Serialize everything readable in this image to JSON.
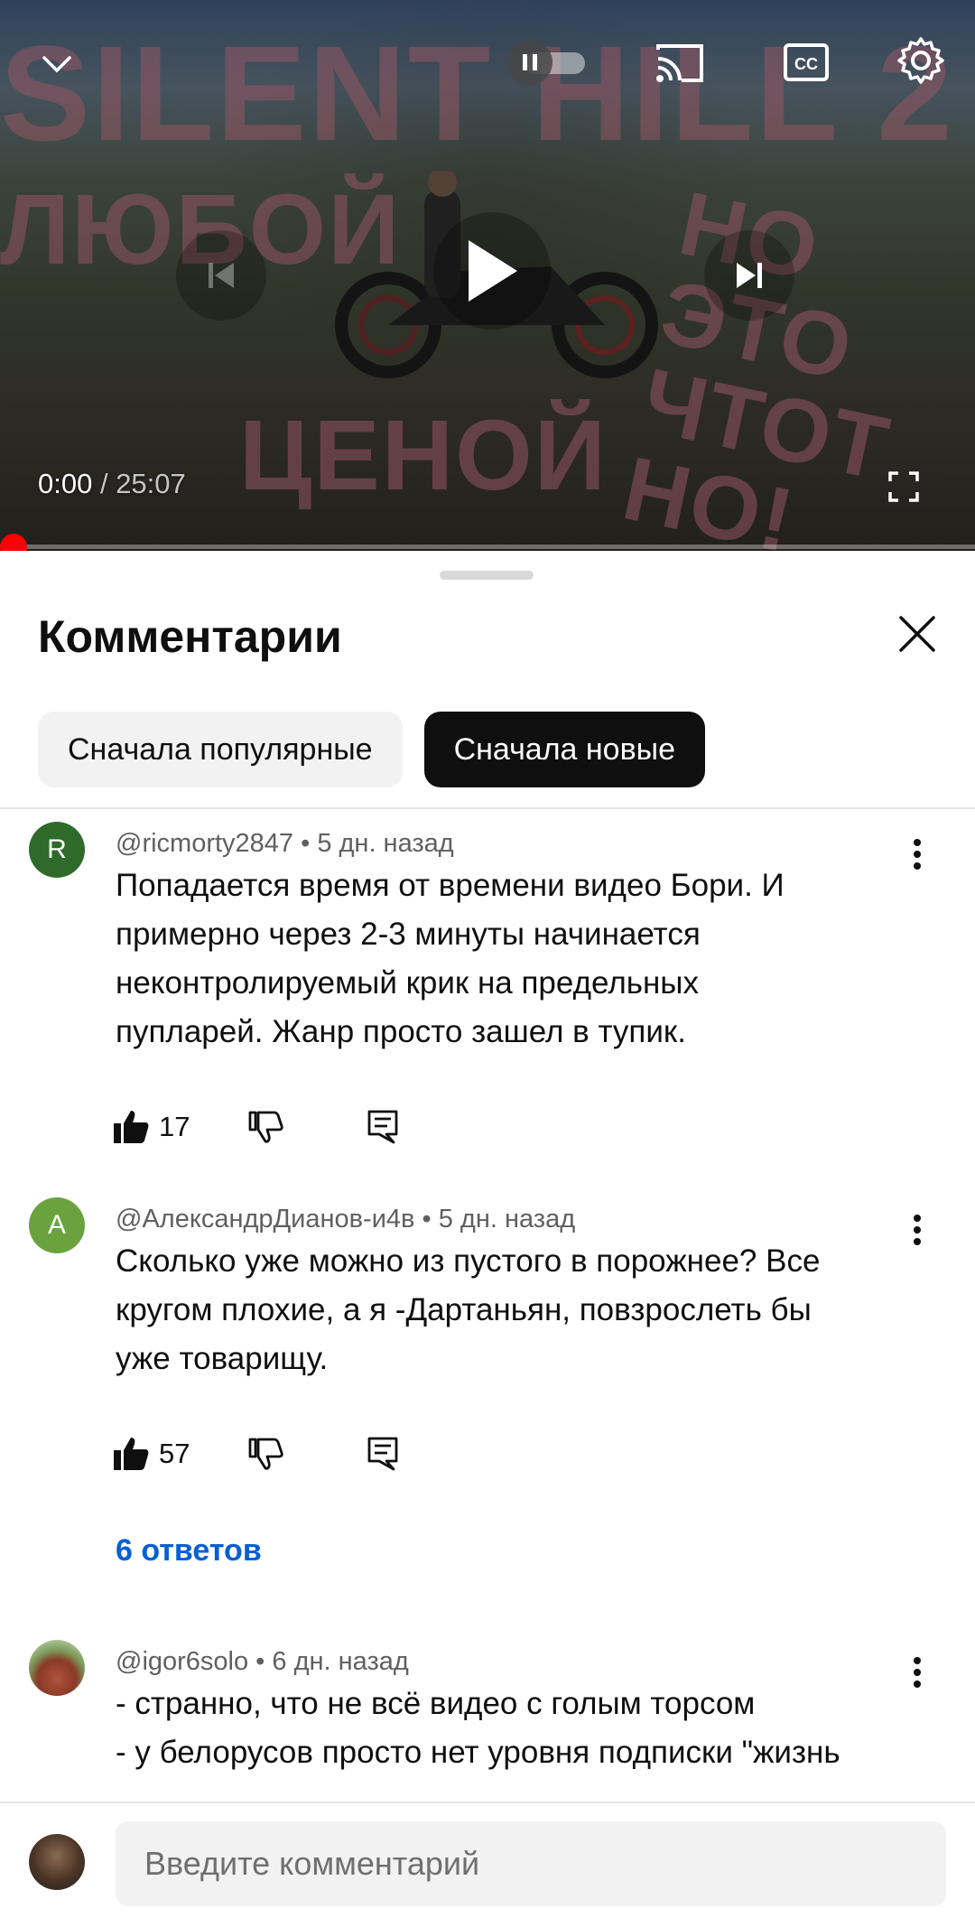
{
  "player": {
    "thumbnail_text": {
      "title": "SILENT HILL 2",
      "left": "ЛЮБОЙ",
      "bottom": "ЦЕНОЙ",
      "right": "НО ЭТО ЧТОТ НО!"
    },
    "time_current": "0:00",
    "time_separator": " / ",
    "time_duration": "25:07",
    "progress_fraction": 0.0,
    "autoplay": true
  },
  "comments_panel": {
    "title": "Комментарии",
    "sort_chips": [
      {
        "label": "Сначала популярные",
        "active": false
      },
      {
        "label": "Сначала новые",
        "active": true
      }
    ],
    "comments": [
      {
        "avatar_letter": "R",
        "avatar_color": "#2e7d32",
        "meta": "@ricmorty2847 • 5 дн. назад",
        "text_lines": [
          "Попадается время от времени видео Бори. И",
          "примерно через 2-3 минуты начинается",
          "неконтролируемый крик на предельных",
          "пупларей. Жанр просто зашел в тупик."
        ],
        "likes": "17"
      },
      {
        "avatar_letter": "А",
        "avatar_color": "#689f38",
        "meta": "@АлександрДианов-и4в • 5 дн. назад",
        "text_lines": [
          "Сколько уже можно из пустого в порожнее? Все",
          "кругом плохие, а я -Дартаньян, повзрослеть бы",
          "уже товарищу."
        ],
        "likes": "57",
        "replies_label": "6 ответов"
      },
      {
        "avatar_letter": "",
        "meta": "@igor6solo • 6 дн. назад",
        "text_lines": [
          "- странно, что не всё видео с голым торсом",
          "- у белорусов просто нет уровня подписки \"жизнь"
        ],
        "likes": ""
      }
    ],
    "input_placeholder": "Введите комментарий"
  },
  "colors": {
    "accent_link": "#065fd4",
    "progress_red": "#ff0000",
    "active_chip": "#0f0f0f"
  }
}
